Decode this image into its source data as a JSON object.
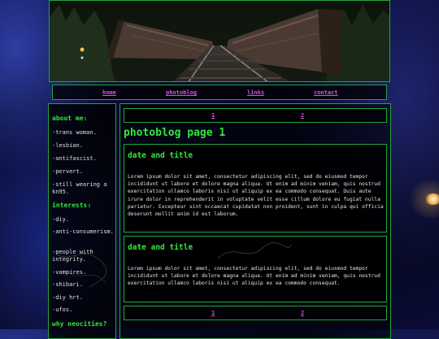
{
  "nav": {
    "home": "home",
    "photoblog": "photoblog",
    "links": "links",
    "contact": "contact"
  },
  "sidebar": {
    "about_heading": "about me:",
    "about_items": [
      "-trans woman.",
      "-lesbian.",
      "-antifascist.",
      "-pervert.",
      "-still wearing a kn95."
    ],
    "interests_heading": "interests:",
    "interests_items": [
      "-diy.",
      "-anti-consumerism.",
      "-people with integrity.",
      "-vampires.",
      "-shibari.",
      "-diy hrt.",
      "-ufos."
    ],
    "why_heading": "why neocities?"
  },
  "pager_top": {
    "p1": "1",
    "p2": "2"
  },
  "page_title": "photoblog page 1",
  "posts": [
    {
      "title": "date and title",
      "body": "Lorem ipsum dolor sit amet, consectetur adipiscing elit, sed do eiusmod tempor incididunt ut labore et dolore magna aliqua. Ut enim ad minim veniam, quis nostrud exercitation ullamco laboris nisi ut aliquip ex ea commodo consequat. Duis aute irure dolor in reprehenderit in voluptate velit esse cillum dolore eu fugiat nulla pariatur. Excepteur sint occaecat cupidatat non proident, sunt in culpa qui officia deserunt mollit anim id est laborum."
    },
    {
      "title": "date and title",
      "body": "Lorem ipsum dolor sit amet, consectetur adipiscing elit, sed do eiusmod tempor incididunt ut labore et dolore magna aliqua. Ut enim ad minim veniam, quis nostrud exercitation ullamco laboris nisi ut aliquip ex ea commodo consequat."
    }
  ],
  "pager_bottom": {
    "p1": "1",
    "p2": "2"
  },
  "colors": {
    "border": "#1fa63a",
    "heading": "#32e83a",
    "link": "#e14be8"
  }
}
